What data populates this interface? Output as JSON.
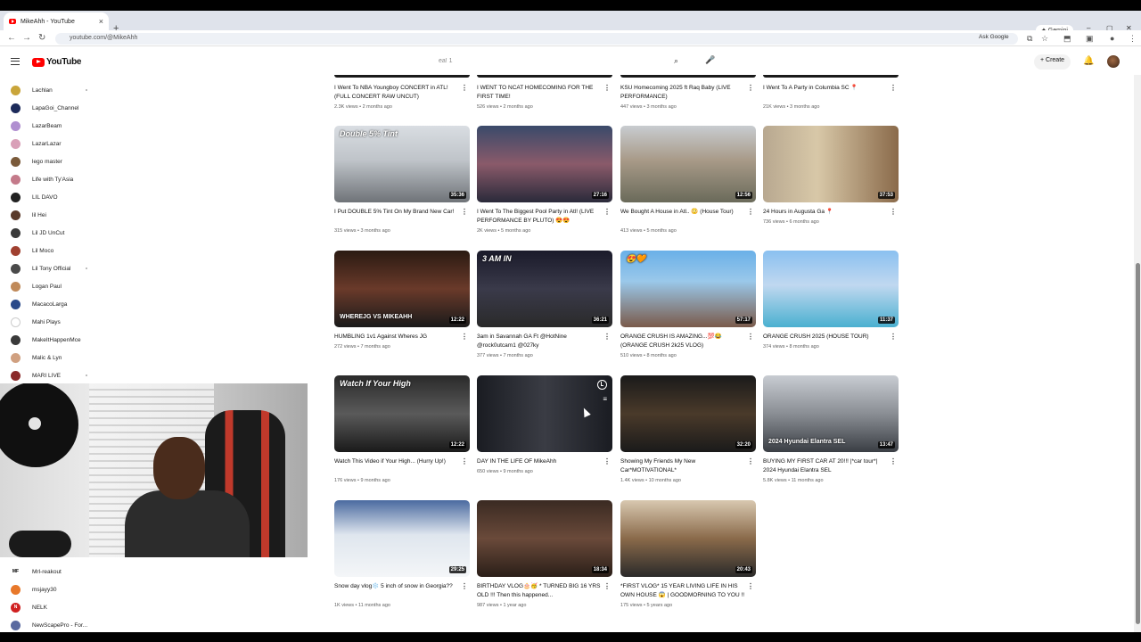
{
  "browser": {
    "tab_title": "MikeAhh - YouTube",
    "new_tab": "+",
    "close": "×",
    "gemini_label": "✦ Gemini",
    "url": "youtube.com/@MikeAhh",
    "ask_google": "Ask Google",
    "nav_back": "←",
    "nav_forward": "→",
    "nav_reload": "↻",
    "win_min": "–",
    "win_max": "▢",
    "win_close": "✕"
  },
  "youtube": {
    "logo_text": "YouTube",
    "search_placeholder": "ea! 1",
    "create_label": "+ Create",
    "bell": "🔔"
  },
  "sidebar": {
    "items": [
      {
        "label": "Lachlan",
        "color": "#c9a53a",
        "dot": true
      },
      {
        "label": "LapaGoi_Channel",
        "color": "#1c2a5a",
        "dot": false
      },
      {
        "label": "LazarBeam",
        "color": "#b08fd0",
        "dot": false
      },
      {
        "label": "LazarLazar",
        "color": "#d9a0b8",
        "dot": false
      },
      {
        "label": "lego master",
        "color": "#7a5a3a",
        "dot": false
      },
      {
        "label": "Life with Ty'Asia",
        "color": "#c47a8a",
        "dot": false
      },
      {
        "label": "LIL DAVO",
        "color": "#222222",
        "dot": false
      },
      {
        "label": "lil Hei",
        "color": "#5a3a2a",
        "dot": false
      },
      {
        "label": "Lil JD UnCut",
        "color": "#3a3a3a",
        "dot": false
      },
      {
        "label": "Lil Moco",
        "color": "#a04030",
        "dot": false
      },
      {
        "label": "Lil Tony Official",
        "color": "#4a4a4a",
        "dot": true
      },
      {
        "label": "Logan Paul",
        "color": "#c08a5a",
        "dot": false
      },
      {
        "label": "MacacoLarga",
        "color": "#2a4a8a",
        "dot": false
      },
      {
        "label": "Mahi Plays",
        "color": "#ffffff",
        "dot": false
      },
      {
        "label": "MakeItHappenMce",
        "color": "#3a3a3a",
        "dot": false
      },
      {
        "label": "Malic & Lyn",
        "color": "#d0a080",
        "dot": false
      },
      {
        "label": "MARI LIVE",
        "color": "#8a2a2a",
        "dot": true
      }
    ],
    "bottom_items": [
      {
        "label": "Mrl-reakout",
        "color": "#ffffff",
        "mark": "MF"
      },
      {
        "label": "msjayy30",
        "color": "#e8782a",
        "mark": ""
      },
      {
        "label": "NELK",
        "color": "#d02020",
        "mark": "N"
      },
      {
        "label": "NewScapePro - For...",
        "color": "#5a6aa0",
        "mark": ""
      }
    ]
  },
  "top_row": [
    {
      "title": "I Went To NBA Youngboy CONCERT in ATL! (FULL CONCERT RAW UNCUT)",
      "meta": "2.3K views • 2 months ago"
    },
    {
      "title": "I WENT TO NCAT HOMECOMING FOR THE FIRST TIME!",
      "meta": "526 views • 2 months ago"
    },
    {
      "title": "KSU Homecoming 2025 ft Raq Baby (LIVE PERFORMANCE)",
      "meta": "447 views • 3 months ago"
    },
    {
      "title": "I Went To A Party in Columbia SC 📍",
      "meta": "21K views • 3 months ago"
    }
  ],
  "videos": [
    {
      "title": "I Put DOUBLE 5% Tint On My Brand New Car!",
      "meta": "315 views • 3 months ago",
      "duration": "35:36",
      "caption": "Double 5% Tint",
      "bg": "linear-gradient(180deg,#d9dde2 0%,#bfc4c9 45%,#6f7378 100%)"
    },
    {
      "title": "I Went To The Biggest Pool Party in Atl! (LIVE PERFORMANCE BY PLUTO) 😍😍",
      "meta": "2K views • 5 months ago",
      "duration": "27:16",
      "caption": "",
      "bg": "linear-gradient(180deg,#3a4a6a 0%,#8a5a6a 50%,#2a2a3a 100%)"
    },
    {
      "title": "We Bought A House in Atl.. 😳 (House Tour)",
      "meta": "413 views • 5 months ago",
      "duration": "12:56",
      "caption": "",
      "bg": "linear-gradient(180deg,#c8ccd0 0%,#a89a88 45%,#6a6a5a 100%)"
    },
    {
      "title": "24 Hours in Augusta Ga 📍",
      "meta": "736 views • 6 months ago",
      "duration": "37:53",
      "caption": "",
      "bg": "linear-gradient(90deg,#b8a890 0%,#d8c8a8 40%,#8a6a4a 100%)"
    },
    {
      "title": "HUMBLING 1v1 Against Wheres JG",
      "meta": "272 views • 7 months ago",
      "duration": "12:22",
      "caption": "WHEREJG VS MIKEAHH",
      "bg": "linear-gradient(180deg,#2a1a12 0%,#6a3a2a 50%,#1a1a1a 100%)"
    },
    {
      "title": "3am in Savannah GA Ft @HotNine @rock0utcam1 @027ky",
      "meta": "377 views • 7 months ago",
      "duration": "36:21",
      "caption": "3 AM IN",
      "bg": "linear-gradient(180deg,#1a1a2a 0%,#3a3a4a 50%,#2a2a2a 100%)"
    },
    {
      "title": "ORANGE CRUSH IS AMAZING...💯😂 (ORANGE CRUSH 2k25 VLOG)",
      "meta": "510 views • 8 months ago",
      "duration": "57:17",
      "caption": "😍🧡",
      "bg": "linear-gradient(180deg,#6ab0e8 0%,#9ac8ea 40%,#7a5a4a 100%)"
    },
    {
      "title": "ORANGE CRUSH 2025 (HOUSE TOUR)",
      "meta": "374 views • 8 months ago",
      "duration": "11:37",
      "caption": "",
      "bg": "linear-gradient(180deg,#8ac0f0 0%,#c0d8f0 45%,#4ab0d0 100%)"
    },
    {
      "title": "Watch This Video if Your High... (Hurry Up!)",
      "meta": "176 views • 9 months ago",
      "duration": "12:22",
      "caption": "Watch If Your High",
      "bg": "linear-gradient(180deg,#2a2a2a 0%,#5a5a5a 50%,#1a1a1a 100%)"
    },
    {
      "title": "DAY IN THE LIFE OF MikeAhh",
      "meta": "650 views • 9 months ago",
      "duration": "",
      "caption": "",
      "bg": "linear-gradient(90deg,#1a1c22 0%,#3a3c44 50%,#1a1c22 100%)"
    },
    {
      "title": "Showing My Friends My New Car*MOTIVATIONAL*",
      "meta": "1.4K views • 10 months ago",
      "duration": "32:20",
      "caption": "",
      "bg": "linear-gradient(180deg,#1a1a1a 0%,#4a3a2a 50%,#1a1a1a 100%)"
    },
    {
      "title": "BUYING MY FIRST CAR AT 20!!! |*car tour*| 2024 Hyundai Elantra SEL",
      "meta": "5.8K views • 11 months ago",
      "duration": "13:47",
      "caption": "2024 Hyundai Elantra SEL",
      "bg": "linear-gradient(180deg,#c8ccd2 0%,#8a8e94 50%,#3a3e44 100%)"
    },
    {
      "title": "Snow day vlog❄️ 5 inch of snow in Georgia??",
      "meta": "1K views • 11 months ago",
      "duration": "29:25",
      "caption": "",
      "bg": "linear-gradient(180deg,#4a6aa0 0%,#dfe6ee 45%,#f4f6f8 100%)"
    },
    {
      "title": "BIRTHDAY VLOG🎂🥳 * TURNED BIG 16 YRS OLD !!! Then this happened...",
      "meta": "987 views • 1 year ago",
      "duration": "18:34",
      "caption": "",
      "bg": "linear-gradient(180deg,#3a2a22 0%,#6a4a3a 50%,#2a1e18 100%)"
    },
    {
      "title": "*FIRST VLOG* 15 YEAR LIVING LIFE IN HIS OWN HOUSE 😱 | GOODMORNING TO YOU !!",
      "meta": "175 views • 5 years ago",
      "duration": "20:43",
      "caption": "",
      "bg": "linear-gradient(180deg,#d8c8b0 0%,#8a6a4a 50%,#2a2a2a 100%)"
    }
  ]
}
